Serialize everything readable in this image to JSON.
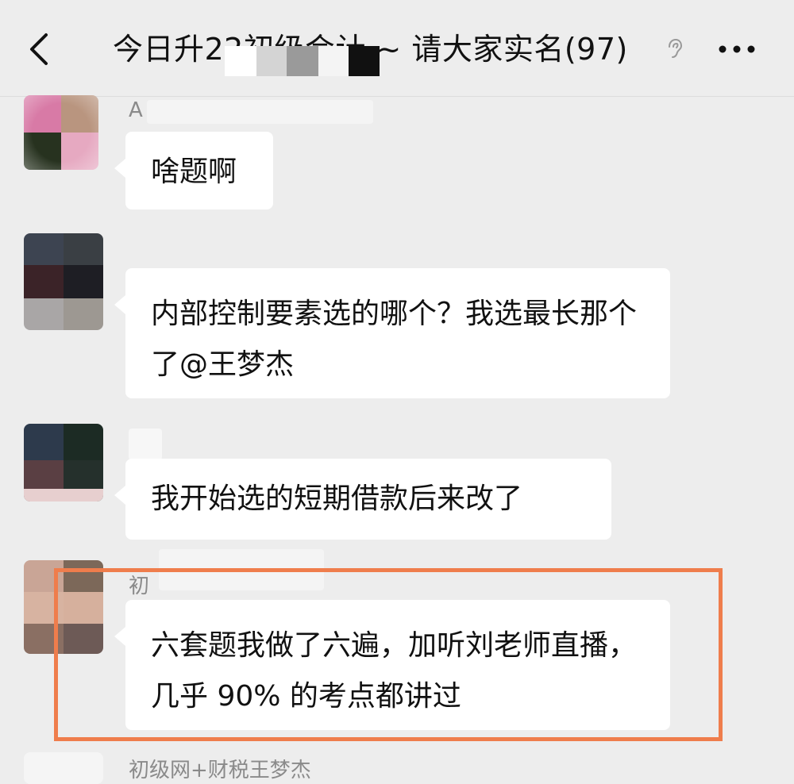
{
  "header": {
    "title": "今日升22初级会计 ~ 请大家实名(97)",
    "back_icon": "chevron-left-icon",
    "more_icon": "more-dots-icon",
    "mute_icon": "ear-icon"
  },
  "messages": [
    {
      "sender": "A",
      "text": "啥题啊"
    },
    {
      "sender": "",
      "text": "内部控制要素选的哪个？我选最长那个了@王梦杰"
    },
    {
      "sender": "",
      "text": "我开始选的短期借款后来改了"
    },
    {
      "sender": "初",
      "text": "六套题我做了六遍，加听刘老师直播，几乎 90% 的考点都讲过",
      "highlighted": true
    },
    {
      "sender": "初级网+财税王梦杰",
      "text": ""
    }
  ],
  "colors": {
    "background": "#ededed",
    "bubble": "#ffffff",
    "highlight": "#ef7d4c"
  }
}
